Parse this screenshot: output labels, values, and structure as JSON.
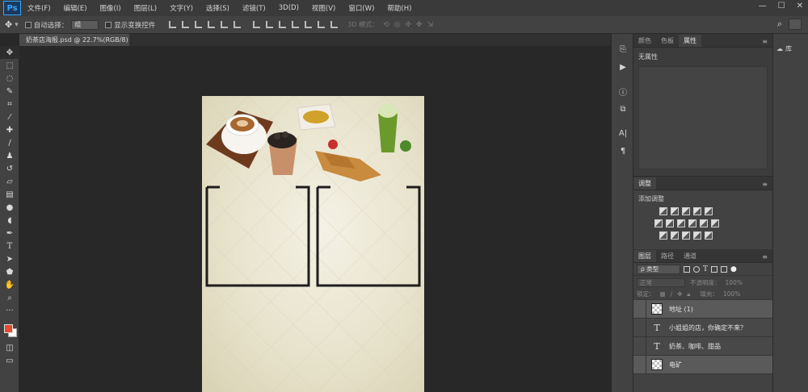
{
  "app": {
    "logo": "Ps"
  },
  "menu": [
    "文件(F)",
    "编辑(E)",
    "图像(I)",
    "图层(L)",
    "文字(Y)",
    "选择(S)",
    "滤镜(T)",
    "3D(D)",
    "视图(V)",
    "窗口(W)",
    "帮助(H)"
  ],
  "options": {
    "auto_select_label": "自动选择：",
    "auto_select_value": "组",
    "show_transform_label": "显示变换控件",
    "mode_3d_label": "3D 模式："
  },
  "document": {
    "tab_title": "奶茶店海报.psd @ 22.7%(RGB/8) *"
  },
  "panels": {
    "top_tabs": [
      "颜色",
      "色板",
      "属性"
    ],
    "properties_text": "无属性",
    "adjustments_tab": "调整",
    "adjustments_title": "添加调整",
    "layers_tabs": [
      "图层",
      "路径",
      "通道"
    ],
    "kind_filter": "ρ 类型",
    "blend_mode": "正常",
    "opacity_label": "不透明度：",
    "opacity_value": "100%",
    "lock_label": "锁定：",
    "fill_label": "填充：",
    "fill_value": "100%",
    "layers": [
      {
        "name": "地址 (1)",
        "type": "image"
      },
      {
        "name": "小姐姐的店，你确定不来？",
        "type": "text"
      },
      {
        "name": "奶茶、咖啡、甜品",
        "type": "text"
      },
      {
        "name": "电矿",
        "type": "image"
      }
    ]
  },
  "libraries": {
    "label": "库"
  },
  "colors": {
    "foreground": "#e64b2e",
    "background": "#ffffff",
    "ps_blue": "#31a8ff"
  }
}
